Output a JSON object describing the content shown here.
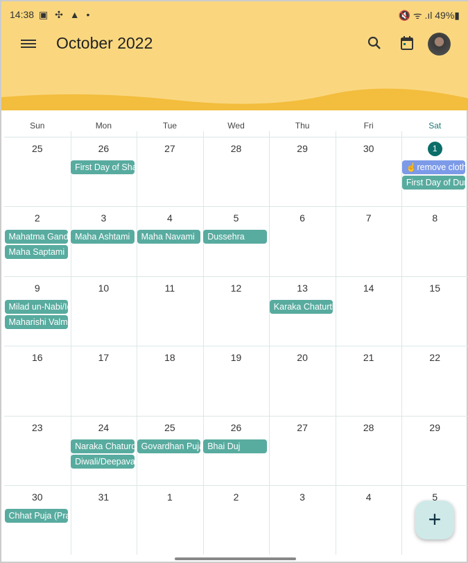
{
  "status": {
    "time": "14:38",
    "icons": "▣ ✣ ▲ •",
    "right": "🔇 ᯤ .ıl 49%▮"
  },
  "header": {
    "title": "October 2022",
    "menu_icon": "hamburger-icon",
    "search_icon": "search-icon",
    "today_icon": "calendar-today-icon"
  },
  "weekdays": [
    "Sun",
    "Mon",
    "Tue",
    "Wed",
    "Thu",
    "Fri",
    "Sat"
  ],
  "colors": {
    "event": "#58ab9f",
    "task": "#7c9ae8",
    "today": "#0b6e68",
    "banner": "#fad77f"
  },
  "weeks": [
    [
      {
        "d": "25",
        "e": []
      },
      {
        "d": "26",
        "e": [
          "First Day of Sharad Navratri"
        ]
      },
      {
        "d": "27",
        "e": []
      },
      {
        "d": "28",
        "e": []
      },
      {
        "d": "29",
        "e": []
      },
      {
        "d": "30",
        "e": []
      },
      {
        "d": "1",
        "today": true,
        "e": [
          "☝remove clothes",
          "First Day of Durga Puja"
        ],
        "task": 0
      }
    ],
    [
      {
        "d": "2",
        "e": [
          "Mahatma Gandhi Jayanti",
          "Maha Saptami"
        ]
      },
      {
        "d": "3",
        "e": [
          "Maha Ashtami"
        ]
      },
      {
        "d": "4",
        "e": [
          "Maha Navami"
        ]
      },
      {
        "d": "5",
        "e": [
          "Dussehra"
        ]
      },
      {
        "d": "6",
        "e": []
      },
      {
        "d": "7",
        "e": []
      },
      {
        "d": "8",
        "e": []
      }
    ],
    [
      {
        "d": "9",
        "e": [
          "Milad un-Nabi/Id-e-Milad",
          "Maharishi Valmiki Jayanti"
        ]
      },
      {
        "d": "10",
        "e": []
      },
      {
        "d": "11",
        "e": []
      },
      {
        "d": "12",
        "e": []
      },
      {
        "d": "13",
        "e": [
          "Karaka Chaturthi"
        ]
      },
      {
        "d": "14",
        "e": []
      },
      {
        "d": "15",
        "e": []
      }
    ],
    [
      {
        "d": "16",
        "e": []
      },
      {
        "d": "17",
        "e": []
      },
      {
        "d": "18",
        "e": []
      },
      {
        "d": "19",
        "e": []
      },
      {
        "d": "20",
        "e": []
      },
      {
        "d": "21",
        "e": []
      },
      {
        "d": "22",
        "e": []
      }
    ],
    [
      {
        "d": "23",
        "e": []
      },
      {
        "d": "24",
        "e": [
          "Naraka Chaturdasi",
          "Diwali/Deepavali"
        ]
      },
      {
        "d": "25",
        "e": [
          "Govardhan Puja"
        ]
      },
      {
        "d": "26",
        "e": [
          "Bhai Duj"
        ]
      },
      {
        "d": "27",
        "e": []
      },
      {
        "d": "28",
        "e": []
      },
      {
        "d": "29",
        "e": []
      }
    ],
    [
      {
        "d": "30",
        "e": [
          "Chhat Puja (Pratihar Sashthi/Surya Sashthi)"
        ]
      },
      {
        "d": "31",
        "e": []
      },
      {
        "d": "1",
        "e": []
      },
      {
        "d": "2",
        "e": []
      },
      {
        "d": "3",
        "e": []
      },
      {
        "d": "4",
        "e": []
      },
      {
        "d": "5",
        "e": []
      }
    ]
  ],
  "fab": {
    "label": "+",
    "icon": "plus-icon"
  }
}
